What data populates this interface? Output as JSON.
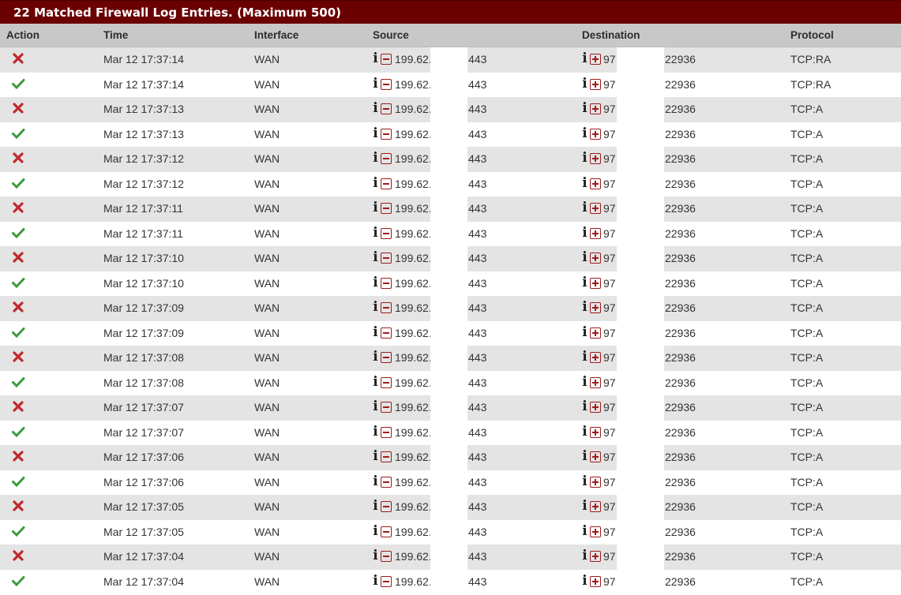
{
  "panel": {
    "title": "22 Matched Firewall Log Entries. (Maximum 500)"
  },
  "columns": {
    "action": "Action",
    "time": "Time",
    "interface": "Interface",
    "source": "Source",
    "destination": "Destination",
    "protocol": "Protocol"
  },
  "colors": {
    "heading_bg": "#6b0000",
    "block_icon": "#c0282e",
    "pass_icon": "#3a9a3a",
    "row_alt": "#e4e4e4"
  },
  "icons": {
    "block": "block-x-icon",
    "pass": "pass-check-icon",
    "info": "info-icon",
    "source_action": "minus-box-icon",
    "dest_action": "plus-box-icon"
  },
  "rows": [
    {
      "action": "block",
      "time": "Mar 12 17:37:14",
      "interface": "WAN",
      "src_ip": "199.62.",
      "src_port": "443",
      "dst_ip": "97",
      "dst_port": "22936",
      "protocol": "TCP:RA"
    },
    {
      "action": "pass",
      "time": "Mar 12 17:37:14",
      "interface": "WAN",
      "src_ip": "199.62.",
      "src_port": "443",
      "dst_ip": "97",
      "dst_port": "22936",
      "protocol": "TCP:RA"
    },
    {
      "action": "block",
      "time": "Mar 12 17:37:13",
      "interface": "WAN",
      "src_ip": "199.62.",
      "src_port": "443",
      "dst_ip": "97",
      "dst_port": "22936",
      "protocol": "TCP:A"
    },
    {
      "action": "pass",
      "time": "Mar 12 17:37:13",
      "interface": "WAN",
      "src_ip": "199.62.",
      "src_port": "443",
      "dst_ip": "97",
      "dst_port": "22936",
      "protocol": "TCP:A"
    },
    {
      "action": "block",
      "time": "Mar 12 17:37:12",
      "interface": "WAN",
      "src_ip": "199.62.",
      "src_port": "443",
      "dst_ip": "97",
      "dst_port": "22936",
      "protocol": "TCP:A"
    },
    {
      "action": "pass",
      "time": "Mar 12 17:37:12",
      "interface": "WAN",
      "src_ip": "199.62.",
      "src_port": "443",
      "dst_ip": "97",
      "dst_port": "22936",
      "protocol": "TCP:A"
    },
    {
      "action": "block",
      "time": "Mar 12 17:37:11",
      "interface": "WAN",
      "src_ip": "199.62.",
      "src_port": "443",
      "dst_ip": "97",
      "dst_port": "22936",
      "protocol": "TCP:A"
    },
    {
      "action": "pass",
      "time": "Mar 12 17:37:11",
      "interface": "WAN",
      "src_ip": "199.62.",
      "src_port": "443",
      "dst_ip": "97",
      "dst_port": "22936",
      "protocol": "TCP:A"
    },
    {
      "action": "block",
      "time": "Mar 12 17:37:10",
      "interface": "WAN",
      "src_ip": "199.62.",
      "src_port": "443",
      "dst_ip": "97",
      "dst_port": "22936",
      "protocol": "TCP:A"
    },
    {
      "action": "pass",
      "time": "Mar 12 17:37:10",
      "interface": "WAN",
      "src_ip": "199.62.",
      "src_port": "443",
      "dst_ip": "97",
      "dst_port": "22936",
      "protocol": "TCP:A"
    },
    {
      "action": "block",
      "time": "Mar 12 17:37:09",
      "interface": "WAN",
      "src_ip": "199.62.",
      "src_port": "443",
      "dst_ip": "97",
      "dst_port": "22936",
      "protocol": "TCP:A"
    },
    {
      "action": "pass",
      "time": "Mar 12 17:37:09",
      "interface": "WAN",
      "src_ip": "199.62.",
      "src_port": "443",
      "dst_ip": "97",
      "dst_port": "22936",
      "protocol": "TCP:A"
    },
    {
      "action": "block",
      "time": "Mar 12 17:37:08",
      "interface": "WAN",
      "src_ip": "199.62.",
      "src_port": "443",
      "dst_ip": "97",
      "dst_port": "22936",
      "protocol": "TCP:A"
    },
    {
      "action": "pass",
      "time": "Mar 12 17:37:08",
      "interface": "WAN",
      "src_ip": "199.62.",
      "src_port": "443",
      "dst_ip": "97",
      "dst_port": "22936",
      "protocol": "TCP:A"
    },
    {
      "action": "block",
      "time": "Mar 12 17:37:07",
      "interface": "WAN",
      "src_ip": "199.62.",
      "src_port": "443",
      "dst_ip": "97",
      "dst_port": "22936",
      "protocol": "TCP:A"
    },
    {
      "action": "pass",
      "time": "Mar 12 17:37:07",
      "interface": "WAN",
      "src_ip": "199.62.",
      "src_port": "443",
      "dst_ip": "97",
      "dst_port": "22936",
      "protocol": "TCP:A"
    },
    {
      "action": "block",
      "time": "Mar 12 17:37:06",
      "interface": "WAN",
      "src_ip": "199.62.",
      "src_port": "443",
      "dst_ip": "97",
      "dst_port": "22936",
      "protocol": "TCP:A"
    },
    {
      "action": "pass",
      "time": "Mar 12 17:37:06",
      "interface": "WAN",
      "src_ip": "199.62.",
      "src_port": "443",
      "dst_ip": "97",
      "dst_port": "22936",
      "protocol": "TCP:A"
    },
    {
      "action": "block",
      "time": "Mar 12 17:37:05",
      "interface": "WAN",
      "src_ip": "199.62.",
      "src_port": "443",
      "dst_ip": "97",
      "dst_port": "22936",
      "protocol": "TCP:A"
    },
    {
      "action": "pass",
      "time": "Mar 12 17:37:05",
      "interface": "WAN",
      "src_ip": "199.62.",
      "src_port": "443",
      "dst_ip": "97",
      "dst_port": "22936",
      "protocol": "TCP:A"
    },
    {
      "action": "block",
      "time": "Mar 12 17:37:04",
      "interface": "WAN",
      "src_ip": "199.62.",
      "src_port": "443",
      "dst_ip": "97",
      "dst_port": "22936",
      "protocol": "TCP:A"
    },
    {
      "action": "pass",
      "time": "Mar 12 17:37:04",
      "interface": "WAN",
      "src_ip": "199.62.",
      "src_port": "443",
      "dst_ip": "97",
      "dst_port": "22936",
      "protocol": "TCP:A"
    }
  ]
}
